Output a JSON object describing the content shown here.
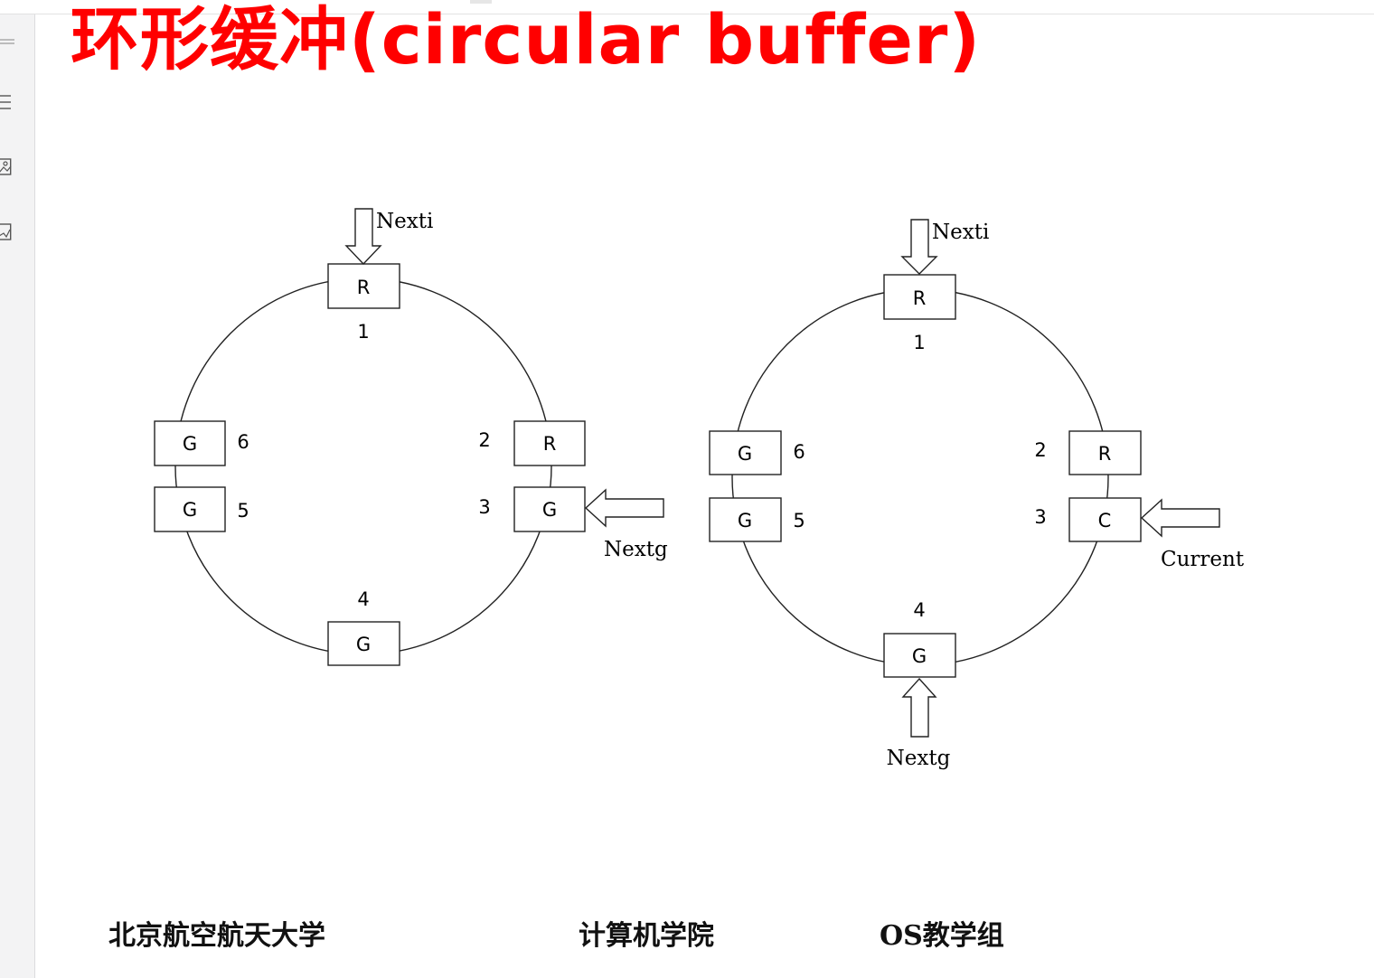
{
  "slide": {
    "title": "环形缓冲(circular buffer)"
  },
  "sidebar": {
    "icons": [
      "menu-icon",
      "image-icon",
      "chart-icon"
    ]
  },
  "diagram_left": {
    "top_arrow_label": "Nexti",
    "side_arrow_label": "Nextg",
    "slots": [
      {
        "number": "1",
        "letter": "R"
      },
      {
        "number": "2",
        "letter": "R"
      },
      {
        "number": "3",
        "letter": "G"
      },
      {
        "number": "4",
        "letter": "G"
      },
      {
        "number": "5",
        "letter": "G"
      },
      {
        "number": "6",
        "letter": "G"
      }
    ]
  },
  "diagram_right": {
    "top_arrow_label": "Nexti",
    "side_arrow_label": "Current",
    "bottom_arrow_label": "Nextg",
    "slots": [
      {
        "number": "1",
        "letter": "R"
      },
      {
        "number": "2",
        "letter": "R"
      },
      {
        "number": "3",
        "letter": "C"
      },
      {
        "number": "4",
        "letter": "G"
      },
      {
        "number": "5",
        "letter": "G"
      },
      {
        "number": "6",
        "letter": "G"
      }
    ]
  },
  "footer": {
    "university": "北京航空航天大学",
    "school": "计算机学院",
    "group": "OS教学组"
  }
}
